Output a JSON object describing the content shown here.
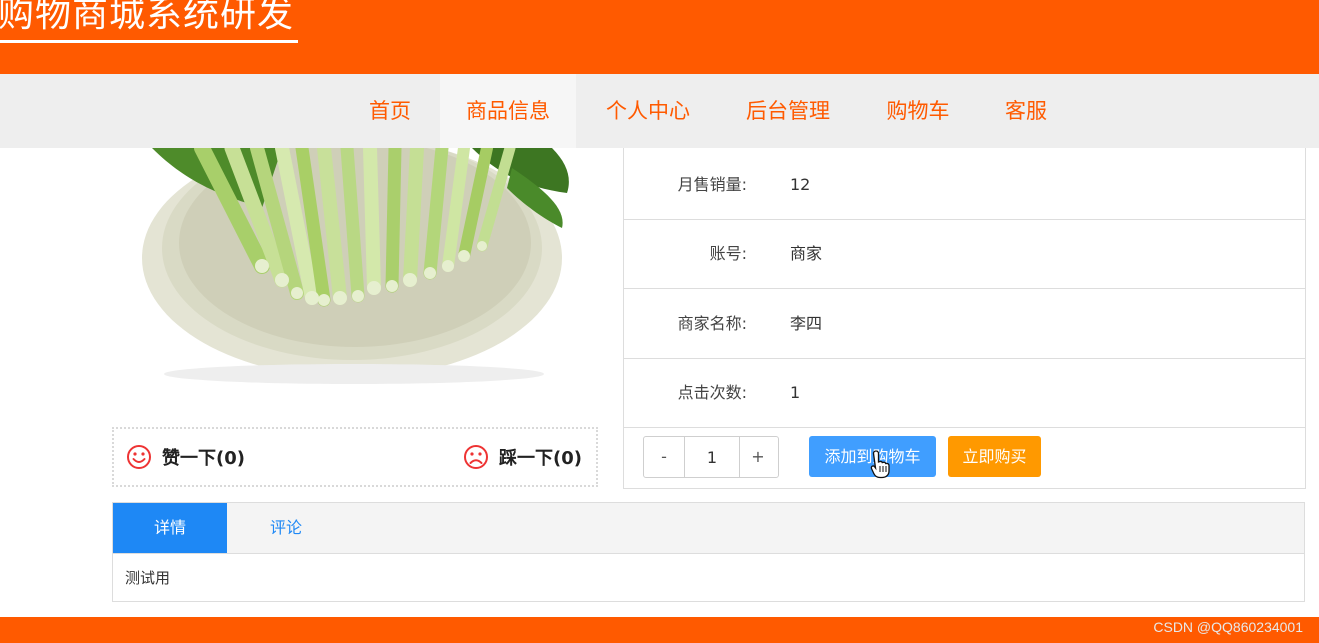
{
  "header": {
    "title": "购物商城系统研发"
  },
  "nav": {
    "items": [
      {
        "label": "首页"
      },
      {
        "label": "商品信息"
      },
      {
        "label": "个人中心"
      },
      {
        "label": "后台管理"
      },
      {
        "label": "购物车"
      },
      {
        "label": "客服"
      }
    ]
  },
  "votes": {
    "like_label": "赞一下(0)",
    "dislike_label": "踩一下(0)"
  },
  "info": {
    "rows": [
      {
        "label": "月售销量:",
        "value": "12"
      },
      {
        "label": "账号:",
        "value": "商家"
      },
      {
        "label": "商家名称:",
        "value": "李四"
      },
      {
        "label": "点击次数:",
        "value": "1"
      }
    ]
  },
  "actions": {
    "minus": "-",
    "quantity": "1",
    "plus": "+",
    "add_to_cart": "添加到购物车",
    "buy_now": "立即购买"
  },
  "tabs": {
    "items": [
      {
        "label": "详情"
      },
      {
        "label": "评论"
      }
    ],
    "content": "测试用"
  },
  "footer": {
    "watermark": "CSDN @QQ860234001"
  },
  "colors": {
    "brand": "#ff5a00",
    "primary": "#409eff",
    "warning": "#ff9900",
    "tab_active": "#1e88f5"
  }
}
